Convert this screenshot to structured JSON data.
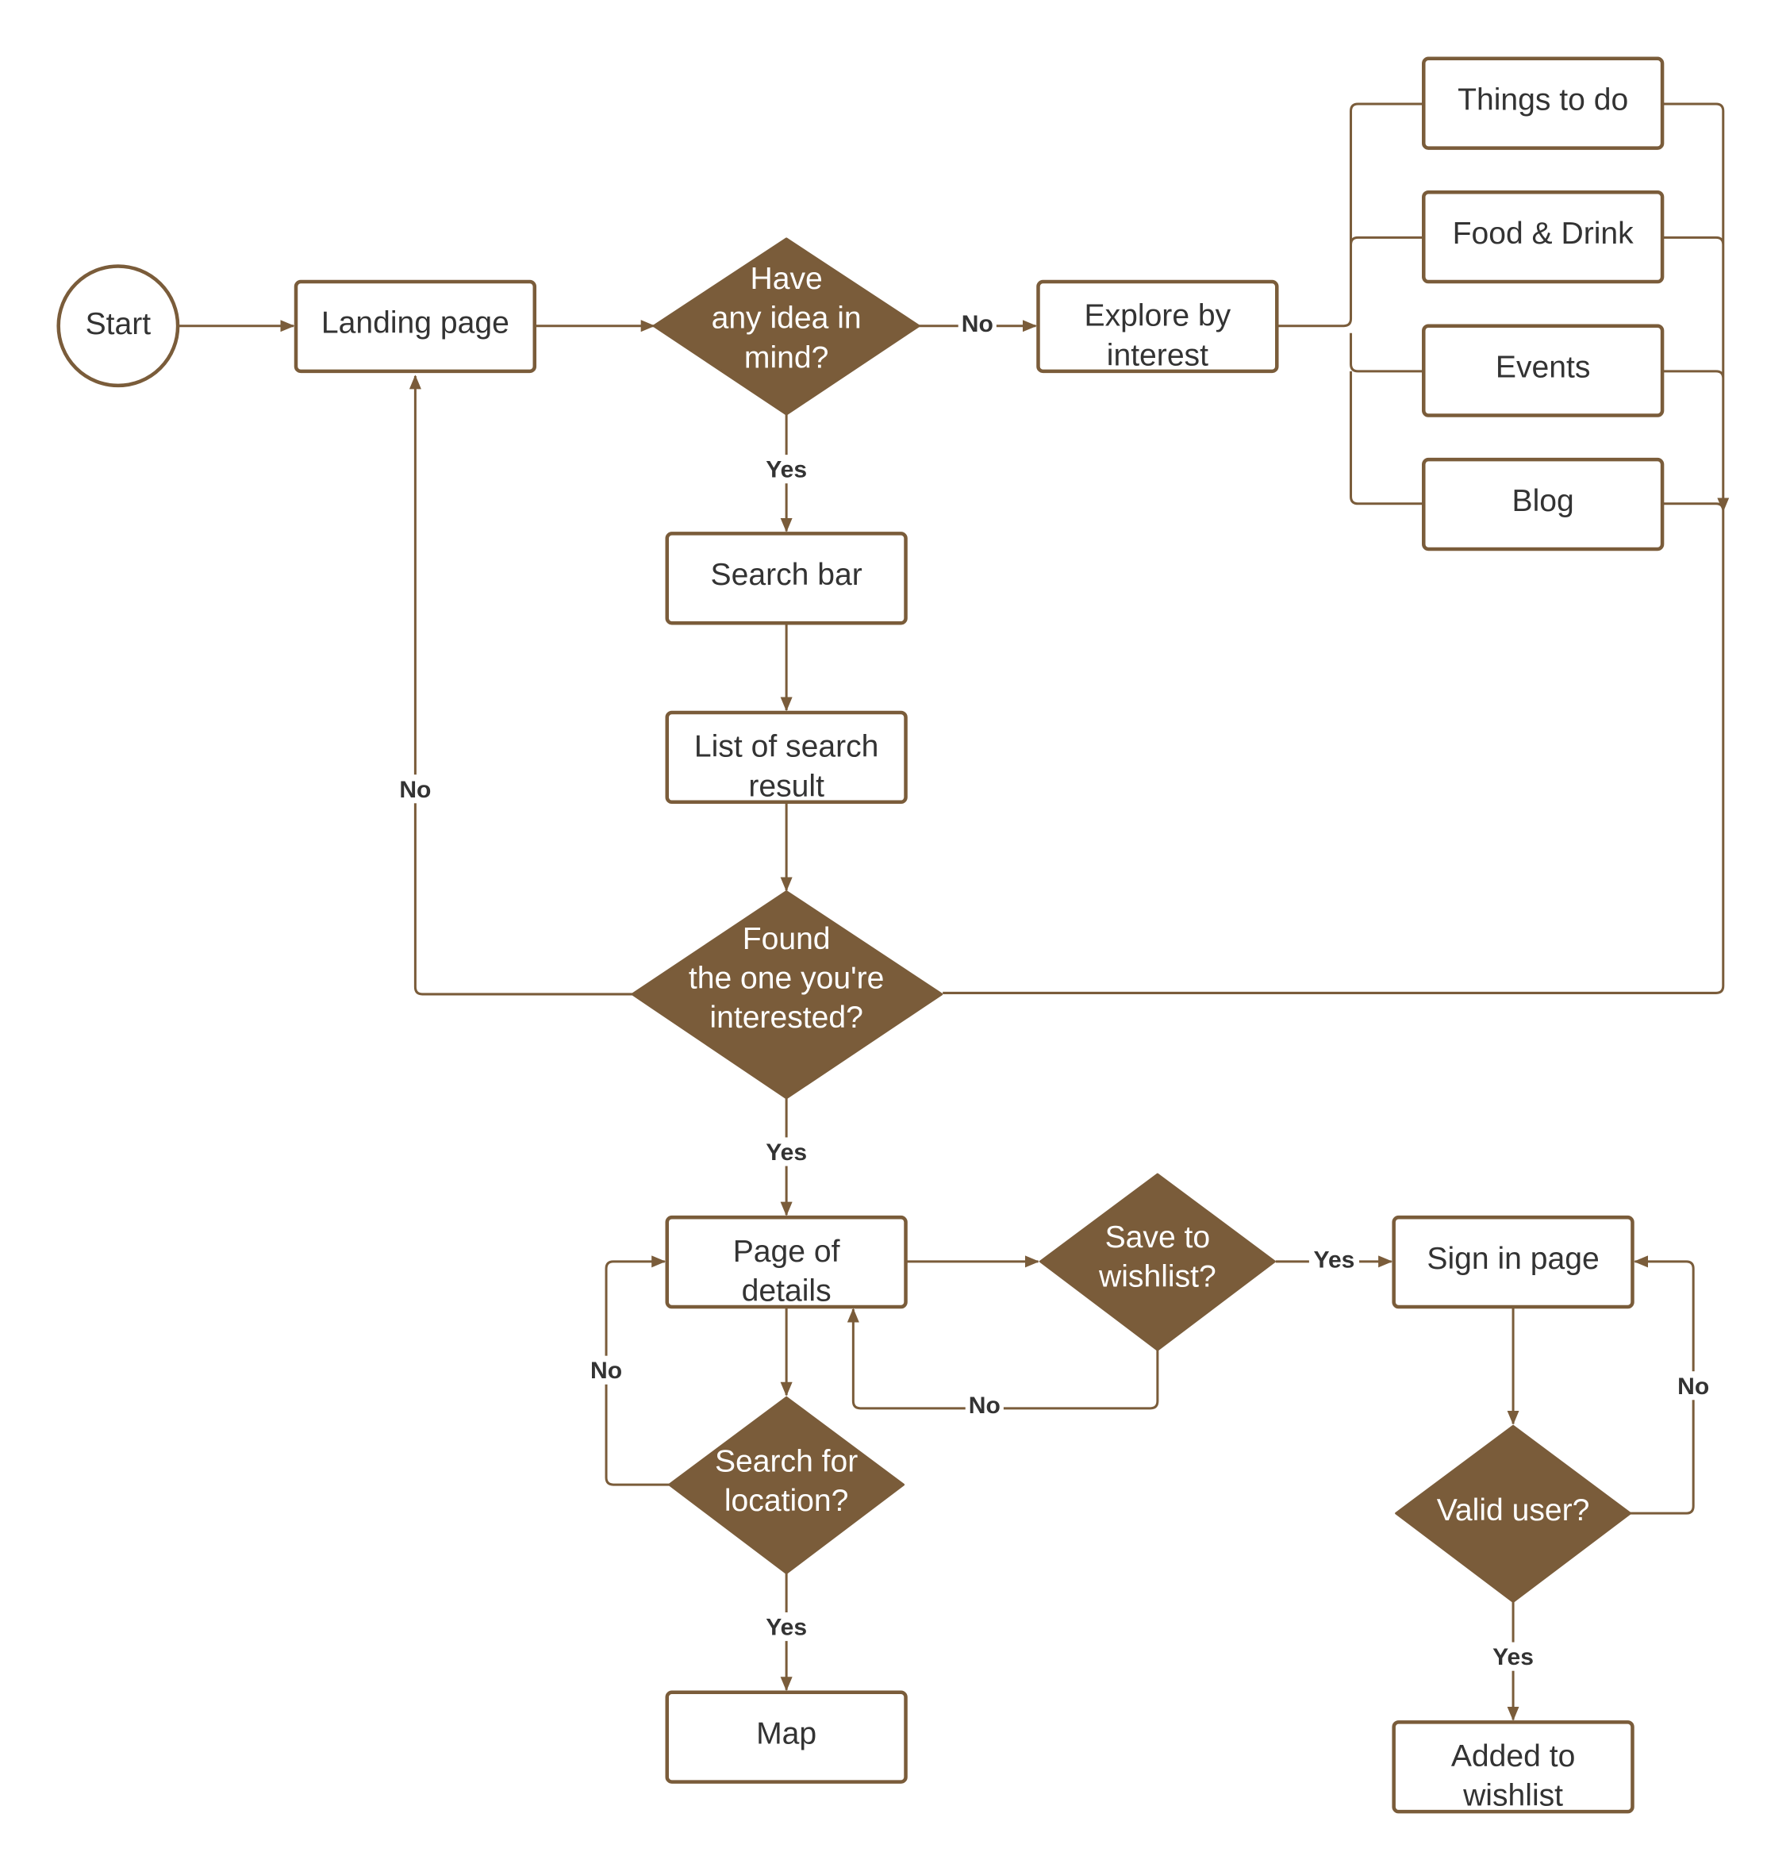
{
  "colors": {
    "accent": "#7a5c3a",
    "text": "#333333",
    "background": "#ffffff"
  },
  "nodes": {
    "start": "Start",
    "landing": "Landing page",
    "idea": [
      "Have",
      "any idea in",
      "mind?"
    ],
    "explore": [
      "Explore by",
      "interest"
    ],
    "things": "Things to do",
    "food": "Food & Drink",
    "events": "Events",
    "blog": "Blog",
    "search_bar": "Search bar",
    "list": [
      "List of search",
      "result"
    ],
    "found": [
      "Found",
      "the one you're",
      "interested?"
    ],
    "details": [
      "Page of",
      "details"
    ],
    "save": [
      "Save to",
      "wishlist?"
    ],
    "signin": "Sign in page",
    "location": [
      "Search for",
      "location?"
    ],
    "valid": "Valid user?",
    "map": "Map",
    "added": [
      "Added to",
      "wishlist"
    ]
  },
  "edges": {
    "idea_no": "No",
    "idea_yes": "Yes",
    "found_no": "No",
    "found_yes": "Yes",
    "save_yes": "Yes",
    "save_no": "No",
    "location_no": "No",
    "location_yes": "Yes",
    "valid_no": "No",
    "valid_yes": "Yes"
  }
}
